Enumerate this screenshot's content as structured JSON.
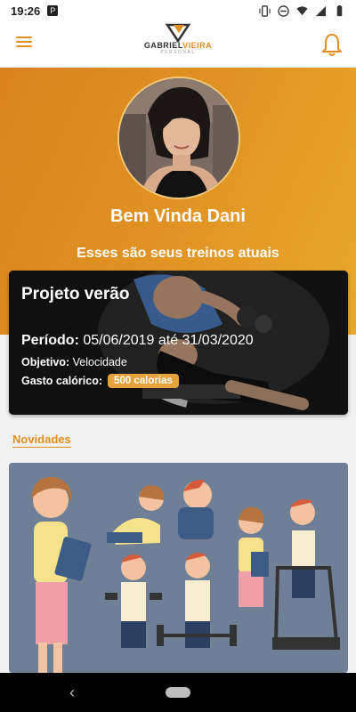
{
  "status_bar": {
    "time": "19:26",
    "left_icon": "P"
  },
  "app_bar": {
    "logo_text_part1": "GABRIEL",
    "logo_text_part2": "VIEIRA",
    "logo_sub": "PERSONAL"
  },
  "hero": {
    "welcome": "Bem Vinda Dani",
    "subtitle": "Esses são seus treinos atuais"
  },
  "training_card": {
    "title": "Projeto verão",
    "period_label": "Período:",
    "period_value": "05/06/2019 até 31/03/2020",
    "objective_label": "Objetivo:",
    "objective_value": "Velocidade",
    "calorie_label": "Gasto calórico:",
    "calorie_value": "500 calorias"
  },
  "news": {
    "label": "Novidades"
  },
  "colors": {
    "accent": "#e08e20",
    "badge": "#e5a33c",
    "news_bg": "#6f7f95"
  },
  "icons": [
    "menu-icon",
    "bell-icon",
    "back-icon",
    "home-icon",
    "wifi-icon",
    "battery-icon",
    "signal-icon"
  ]
}
